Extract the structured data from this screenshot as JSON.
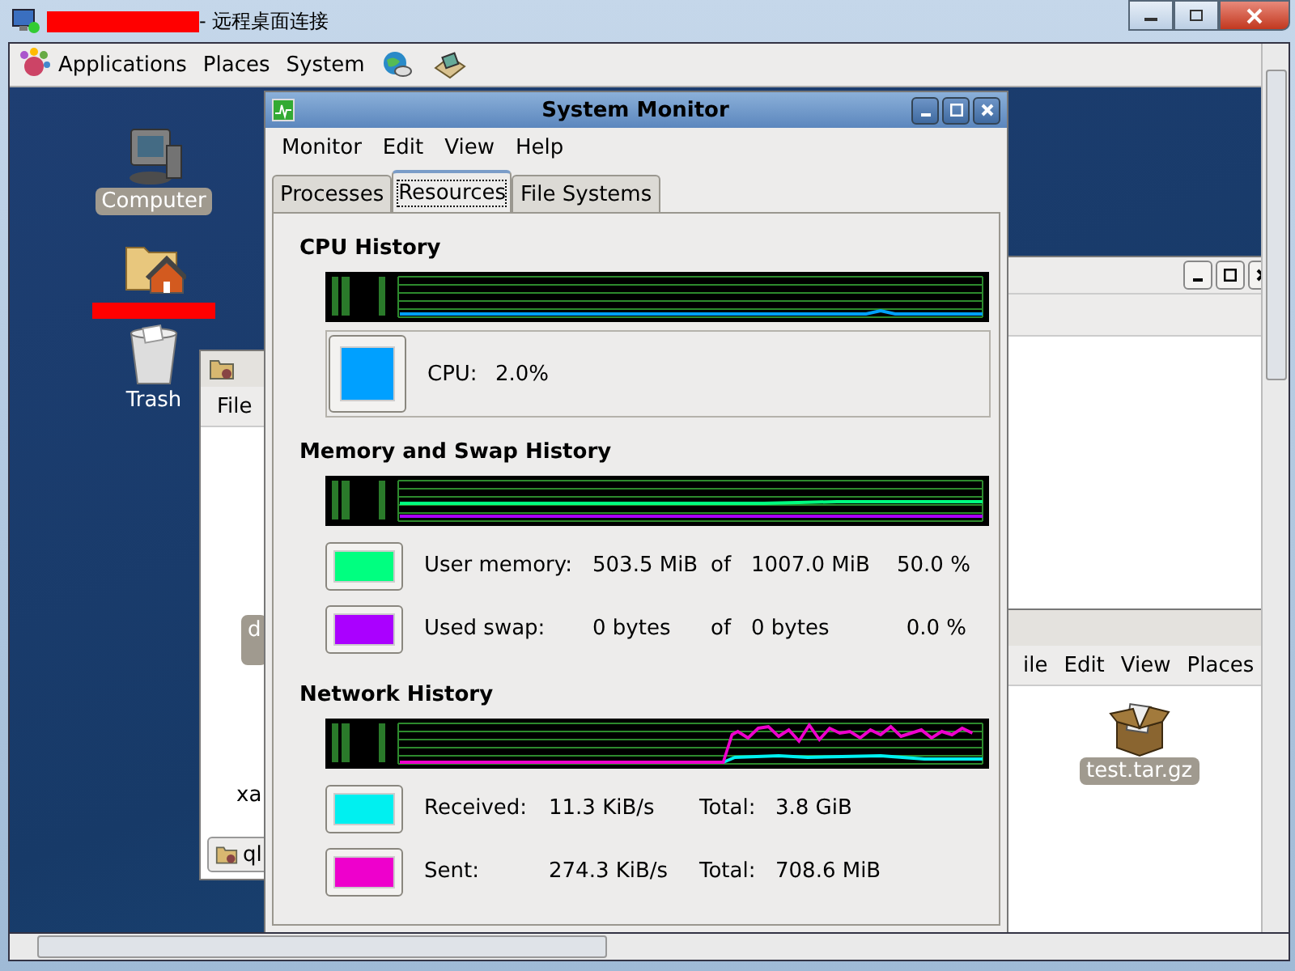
{
  "rdp_window": {
    "title": "- 远程桌面连接"
  },
  "top_panel": {
    "menus": [
      "Applications",
      "Places",
      "System"
    ]
  },
  "desktop_icons": [
    {
      "kind": "computer",
      "label": "Computer",
      "selected": true,
      "redacted": false
    },
    {
      "kind": "home",
      "redacted": true,
      "selected": false
    },
    {
      "kind": "trash",
      "label": "Trash",
      "selected": false,
      "redacted": false
    }
  ],
  "left_window": {
    "menu": [
      "File"
    ],
    "items": [
      {
        "label": "d",
        "selected": true
      },
      {
        "label": "xa",
        "selected": false
      }
    ],
    "task_button": "ql"
  },
  "right_window": {
    "menu": [
      "ile",
      "Edit",
      "View",
      "Places"
    ],
    "files": [
      {
        "label": "test.tar.gz",
        "selected": true
      }
    ]
  },
  "system_monitor": {
    "title": "System Monitor",
    "menu": [
      "Monitor",
      "Edit",
      "View",
      "Help"
    ],
    "tabs": [
      {
        "label": "Processes",
        "selected": false
      },
      {
        "label": "Resources",
        "selected": true
      },
      {
        "label": "File Systems",
        "selected": false
      }
    ],
    "sections": [
      {
        "kind": "cpu",
        "title": "CPU History",
        "rows": [
          {
            "color": "#00a0ff",
            "cells": [
              "CPU:",
              "2.0%"
            ]
          }
        ]
      },
      {
        "kind": "memory",
        "title": "Memory and Swap History",
        "rows": [
          {
            "color": "#00ff80",
            "cells": [
              "User memory:",
              "503.5 MiB",
              "of",
              "1007.0 MiB",
              "50.0 %"
            ]
          },
          {
            "color": "#aa00ff",
            "cells": [
              "Used swap:",
              "0 bytes",
              "of",
              "0 bytes",
              "0.0 %"
            ]
          }
        ]
      },
      {
        "kind": "network",
        "title": "Network History",
        "rows": [
          {
            "color": "#00f0f0",
            "cells": [
              "Received:",
              "11.3 KiB/s",
              "Total:",
              "3.8 GiB"
            ]
          },
          {
            "color": "#ee00cc",
            "cells": [
              "Sent:",
              "274.3 KiB/s",
              "Total:",
              "708.6 MiB"
            ]
          }
        ]
      }
    ]
  }
}
